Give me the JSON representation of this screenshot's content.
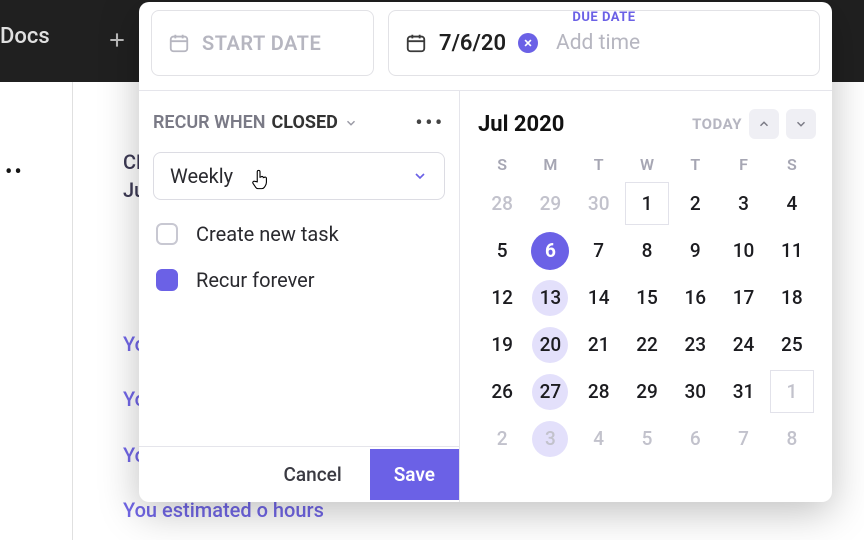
{
  "background": {
    "docs_label": "Docs",
    "left_ellipsis": "••",
    "left_items": [
      {
        "text": "CR"
      },
      {
        "text": "Ju"
      },
      {
        "text": "Yo"
      },
      {
        "text": "Yo"
      },
      {
        "text": "Yo"
      },
      {
        "text": "You  estimated o hours"
      }
    ]
  },
  "modal": {
    "start_date": {
      "placeholder": "START DATE"
    },
    "due_date": {
      "label": "DUE DATE",
      "value": "7/6/20",
      "add_time": "Add time"
    },
    "recur": {
      "prefix": "RECUR WHEN",
      "value": "CLOSED",
      "frequency": "Weekly",
      "options": [
        {
          "key": "create_new_task",
          "label": "Create new task",
          "checked": false
        },
        {
          "key": "recur_forever",
          "label": "Recur forever",
          "checked": true
        }
      ]
    },
    "buttons": {
      "cancel": "Cancel",
      "save": "Save"
    },
    "calendar": {
      "month_label": "Jul 2020",
      "today_label": "TODAY",
      "dow": [
        "S",
        "M",
        "T",
        "W",
        "T",
        "F",
        "S"
      ],
      "grid": [
        {
          "n": 28,
          "muted": true
        },
        {
          "n": 29,
          "muted": true
        },
        {
          "n": 30,
          "muted": true
        },
        {
          "n": 1,
          "box": true
        },
        {
          "n": 2
        },
        {
          "n": 3
        },
        {
          "n": 4
        },
        {
          "n": 5
        },
        {
          "n": 6,
          "selected": true
        },
        {
          "n": 7
        },
        {
          "n": 8
        },
        {
          "n": 9
        },
        {
          "n": 10
        },
        {
          "n": 11
        },
        {
          "n": 12
        },
        {
          "n": 13,
          "hl": true
        },
        {
          "n": 14
        },
        {
          "n": 15
        },
        {
          "n": 16
        },
        {
          "n": 17
        },
        {
          "n": 18
        },
        {
          "n": 19
        },
        {
          "n": 20,
          "hl": true
        },
        {
          "n": 21
        },
        {
          "n": 22
        },
        {
          "n": 23
        },
        {
          "n": 24
        },
        {
          "n": 25
        },
        {
          "n": 26
        },
        {
          "n": 27,
          "hl": true
        },
        {
          "n": 28
        },
        {
          "n": 29
        },
        {
          "n": 30
        },
        {
          "n": 31
        },
        {
          "n": 1,
          "muted": true,
          "box": true
        },
        {
          "n": 2,
          "muted": true
        },
        {
          "n": 3,
          "muted": true,
          "hl": true
        },
        {
          "n": 4,
          "muted": true
        },
        {
          "n": 5,
          "muted": true
        },
        {
          "n": 6,
          "muted": true
        },
        {
          "n": 7,
          "muted": true
        },
        {
          "n": 8,
          "muted": true
        }
      ]
    }
  }
}
